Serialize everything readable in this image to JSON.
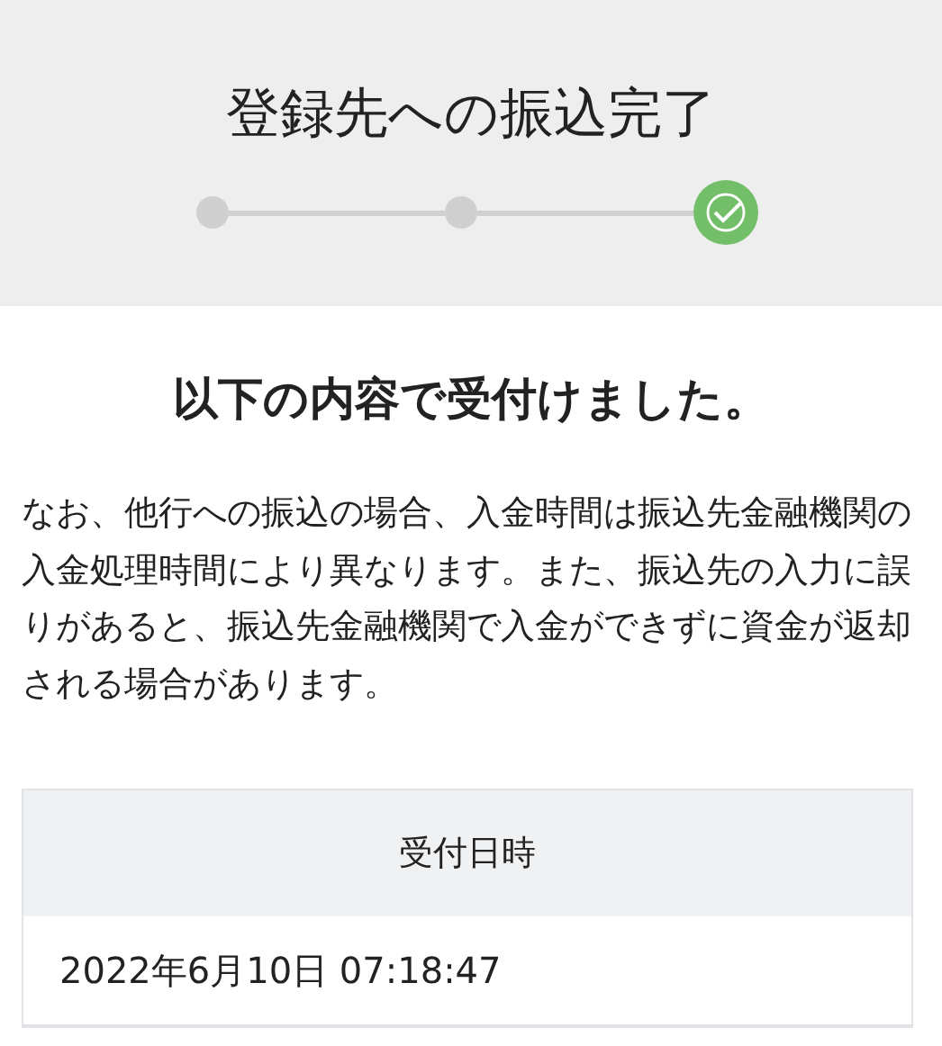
{
  "header": {
    "title": "登録先への振込完了"
  },
  "steps": [
    {
      "current": false
    },
    {
      "current": false
    },
    {
      "current": true
    }
  ],
  "heading": "以下の内容で受付けました。",
  "notice": "なお、他行への振込の場合、入金時間は振込先金融機関の入金処理時間により異なります。また、振込先の入力に誤りがあると、振込先金融機関で入金ができずに資金が返却される場合があります。",
  "table": {
    "rows": [
      {
        "label": "受付日時",
        "value": "2022年6月10日 07:18:47"
      }
    ]
  }
}
